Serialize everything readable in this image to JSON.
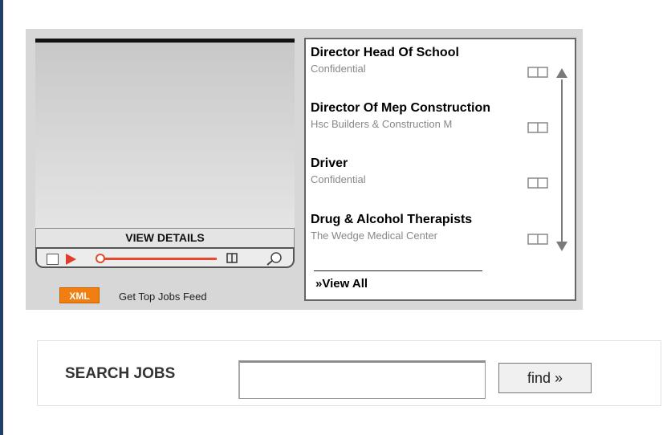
{
  "player": {
    "view_details_label": "VIEW DETAILS",
    "controls": {
      "stop_icon": "stop-square-icon",
      "play_icon": "play-triangle-icon",
      "book_icon": "book-icon",
      "zoom_icon": "magnifier-icon",
      "accent_color": "#e64a2e"
    }
  },
  "feed": {
    "badge_label": "XML",
    "link_label": "Get Top Jobs Feed",
    "badge_color": "#f07e10"
  },
  "jobs": {
    "items": [
      {
        "title": "Director Head Of School",
        "company": "Confidential",
        "icon": "book-icon"
      },
      {
        "title": "Director Of Mep Construction",
        "company": "Hsc Builders & Construction M",
        "icon": "book-icon"
      },
      {
        "title": "Driver",
        "company": "Confidential",
        "icon": "book-icon"
      },
      {
        "title": "Drug & Alcohol Therapists",
        "company": "The Wedge Medical Center",
        "icon": "book-icon"
      }
    ],
    "view_all_label": "»View All",
    "scroll_up_icon": "arrow-up-icon",
    "scroll_down_icon": "arrow-down-icon"
  },
  "search": {
    "label": "SEARCH JOBS",
    "input_value": "",
    "input_placeholder": "",
    "button_label": "find »"
  }
}
